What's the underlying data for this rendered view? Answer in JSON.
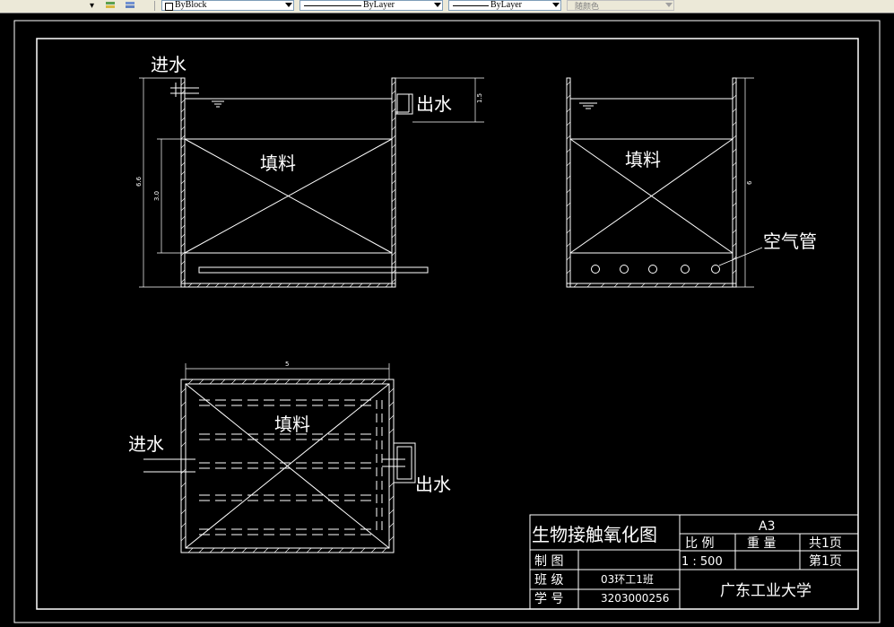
{
  "toolbar": {
    "color_value": "ByBlock",
    "linetype_value": "ByLayer",
    "lineweight_value": "ByLayer",
    "plotstyle_value": "随颜色"
  },
  "drawing": {
    "front_view": {
      "inlet_label": "进水",
      "outlet_label": "出水",
      "fill_label": "填料",
      "dim_total_height": "6.6",
      "dim_fill_height": "3.0",
      "dim_outlet": "1.5"
    },
    "side_view": {
      "fill_label": "填料",
      "air_pipe_label": "空气管",
      "dim_height": "6"
    },
    "plan_view": {
      "dim_width": "5",
      "fill_label": "填料",
      "inlet_label": "进水",
      "outlet_label": "出水"
    }
  },
  "title_block": {
    "drawing_title": "生物接触氧化图",
    "ratio_label": "比  例",
    "ratio_value": "1 : 500",
    "weight_label": "重  量",
    "weight_value": "",
    "total_pages": "共1页",
    "page_no": "第1页",
    "sheet_size": "A3",
    "drafter_label": "制  图",
    "drafter_value": "",
    "class_label": "班  级",
    "class_value": "03环工1班",
    "id_label": "学  号",
    "id_value": "3203000256",
    "school": "广东工业大学"
  },
  "colors": {
    "background": "#000000",
    "line": "#ffffff",
    "toolbar": "#ece9d8"
  }
}
